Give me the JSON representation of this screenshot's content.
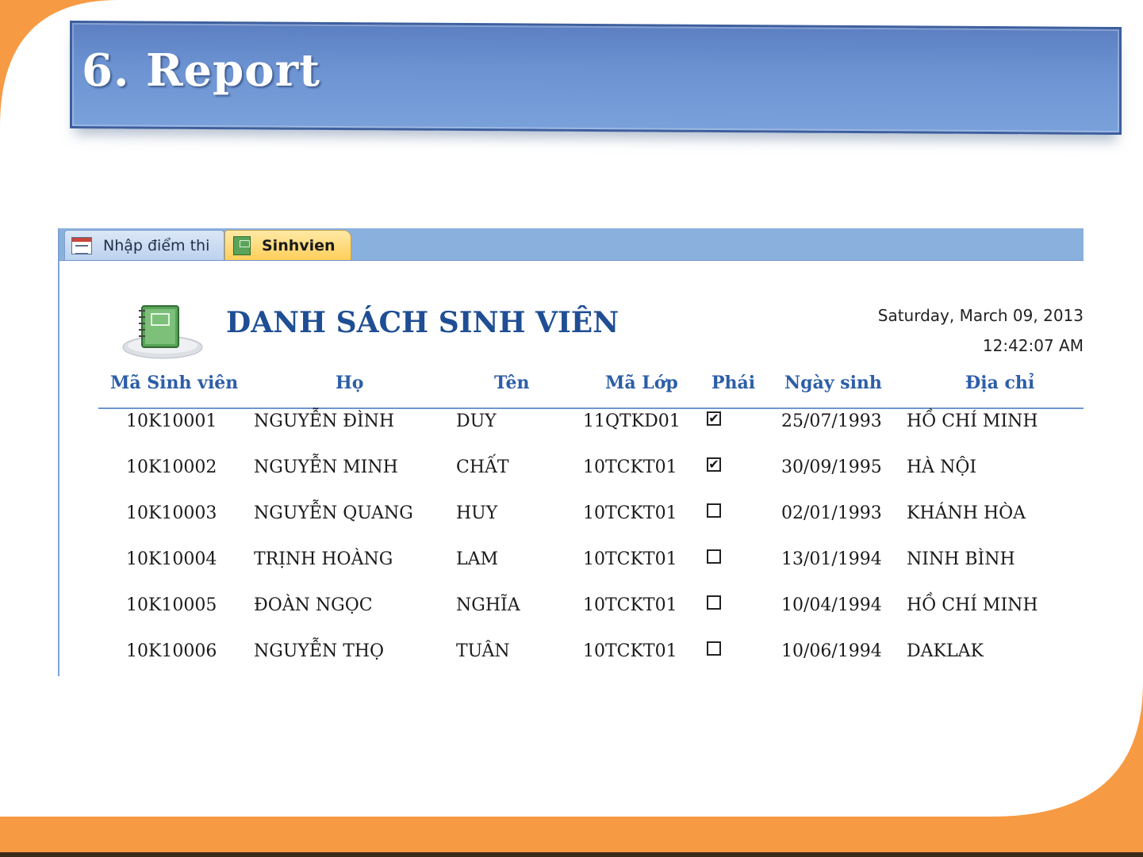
{
  "slide": {
    "title": "6. Report",
    "colors": {
      "orange": "#f79a44",
      "title_bar": "#6d94d2",
      "report_title": "#1f4e94",
      "header_text": "#2c5ea8"
    }
  },
  "tabs": [
    {
      "label": "Nhập điểm thi",
      "icon": "form-icon",
      "active": false
    },
    {
      "label": "Sinhvien",
      "icon": "report-icon",
      "active": true
    }
  ],
  "report": {
    "title": "DANH SÁCH SINH VIÊN",
    "date": "Saturday, March 09, 2013",
    "time": "12:42:07 AM",
    "columns": [
      "Mã Sinh viên",
      "Họ",
      "Tên",
      "Mã Lớp",
      "Phái",
      "Ngày sinh",
      "Địa chỉ"
    ],
    "rows": [
      {
        "ma_sv": "10K10001",
        "ho": "NGUYỄN ĐÌNH",
        "ten": "DUY",
        "ma_lop": "11QTKD01",
        "phai": true,
        "ngay_sinh": "25/07/1993",
        "dia_chi": "HỒ CHÍ MINH"
      },
      {
        "ma_sv": "10K10002",
        "ho": "NGUYỄN MINH",
        "ten": "CHẤT",
        "ma_lop": "10TCKT01",
        "phai": true,
        "ngay_sinh": "30/09/1995",
        "dia_chi": "HÀ NỘI"
      },
      {
        "ma_sv": "10K10003",
        "ho": "NGUYỄN QUANG",
        "ten": "HUY",
        "ma_lop": "10TCKT01",
        "phai": false,
        "ngay_sinh": "02/01/1993",
        "dia_chi": "KHÁNH HÒA"
      },
      {
        "ma_sv": "10K10004",
        "ho": "TRỊNH HOÀNG",
        "ten": "LAM",
        "ma_lop": "10TCKT01",
        "phai": false,
        "ngay_sinh": "13/01/1994",
        "dia_chi": "NINH BÌNH"
      },
      {
        "ma_sv": "10K10005",
        "ho": "ĐOÀN NGỌC",
        "ten": "NGHĨA",
        "ma_lop": "10TCKT01",
        "phai": false,
        "ngay_sinh": "10/04/1994",
        "dia_chi": "HỒ CHÍ MINH"
      },
      {
        "ma_sv": "10K10006",
        "ho": "NGUYỄN THỌ",
        "ten": "TUÂN",
        "ma_lop": "10TCKT01",
        "phai": false,
        "ngay_sinh": "10/06/1994",
        "dia_chi": "DAKLAK"
      }
    ]
  }
}
